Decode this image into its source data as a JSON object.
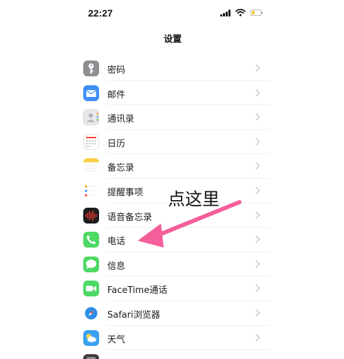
{
  "status_bar": {
    "time": "22:27"
  },
  "nav": {
    "title": "设置"
  },
  "settings": [
    {
      "label": "密码",
      "icon": "key-icon"
    },
    {
      "label": "邮件",
      "icon": "mail-icon"
    },
    {
      "label": "通讯录",
      "icon": "contacts-icon"
    },
    {
      "label": "日历",
      "icon": "calendar-icon"
    },
    {
      "label": "备忘录",
      "icon": "notes-icon"
    },
    {
      "label": "提醒事项",
      "icon": "reminders-icon"
    },
    {
      "label": "语音备忘录",
      "icon": "voice-memos-icon"
    },
    {
      "label": "电话",
      "icon": "phone-icon"
    },
    {
      "label": "信息",
      "icon": "messages-icon"
    },
    {
      "label": "FaceTime通话",
      "icon": "facetime-icon"
    },
    {
      "label": "Safari浏览器",
      "icon": "safari-icon"
    },
    {
      "label": "天气",
      "icon": "weather-icon"
    }
  ],
  "annotation": {
    "text": "点这里"
  },
  "colors": {
    "arrow": "#f45f9a",
    "phone_green": "#4cd964",
    "mail_blue": "#3d8ff5",
    "battery": "#f2c331"
  }
}
